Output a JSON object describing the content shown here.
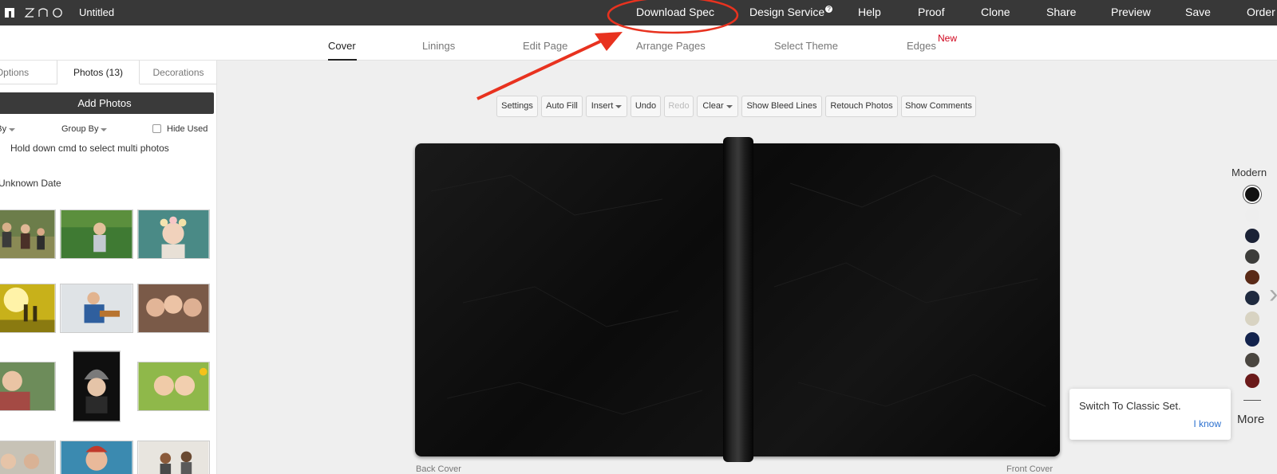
{
  "app": {
    "logo_text": "ZNO",
    "doc_title": "Untitled"
  },
  "topnav": {
    "download_spec": "Download Spec",
    "design_service": "Design Service",
    "design_service_badge": "?",
    "help": "Help",
    "proof": "Proof",
    "clone": "Clone",
    "share": "Share",
    "preview": "Preview",
    "save": "Save",
    "order": "Order"
  },
  "tabs": {
    "cover": "Cover",
    "linings": "Linings",
    "edit_page": "Edit Page",
    "arrange_pages": "Arrange Pages",
    "select_theme": "Select Theme",
    "edges": "Edges",
    "edges_badge": "New",
    "active": "Cover"
  },
  "panel": {
    "tabs": {
      "options": "Options",
      "photos": "Photos (13)",
      "decorations": "Decorations"
    },
    "add_photos": "Add Photos",
    "sort_by": "Sort By",
    "group_by": "Group By",
    "hide_used": "Hide Used",
    "hint": "Hold down cmd to select multi photos",
    "group_label": "Unknown Date"
  },
  "toolbar": {
    "settings": "Settings",
    "auto_fill": "Auto Fill",
    "insert": "Insert",
    "undo": "Undo",
    "redo": "Redo",
    "clear": "Clear",
    "show_bleed": "Show Bleed Lines",
    "retouch": "Retouch Photos",
    "comments": "Show Comments"
  },
  "book": {
    "back_label": "Back Cover",
    "front_label": "Front Cover",
    "material_color": "#111111"
  },
  "swatches": {
    "set_name": "Modern",
    "colors": [
      "#111111",
      "#eeeeee",
      "#1b2236",
      "#3d3d3b",
      "#5a2a17",
      "#1f2a3f",
      "#d8d3c2",
      "#13234d",
      "#4a4640",
      "#6b1a1a"
    ],
    "selected_index": 0,
    "more": "More"
  },
  "tooltip": {
    "text": "Switch To Classic Set.",
    "button": "I know"
  },
  "annotation": {
    "color": "#e8321f"
  }
}
